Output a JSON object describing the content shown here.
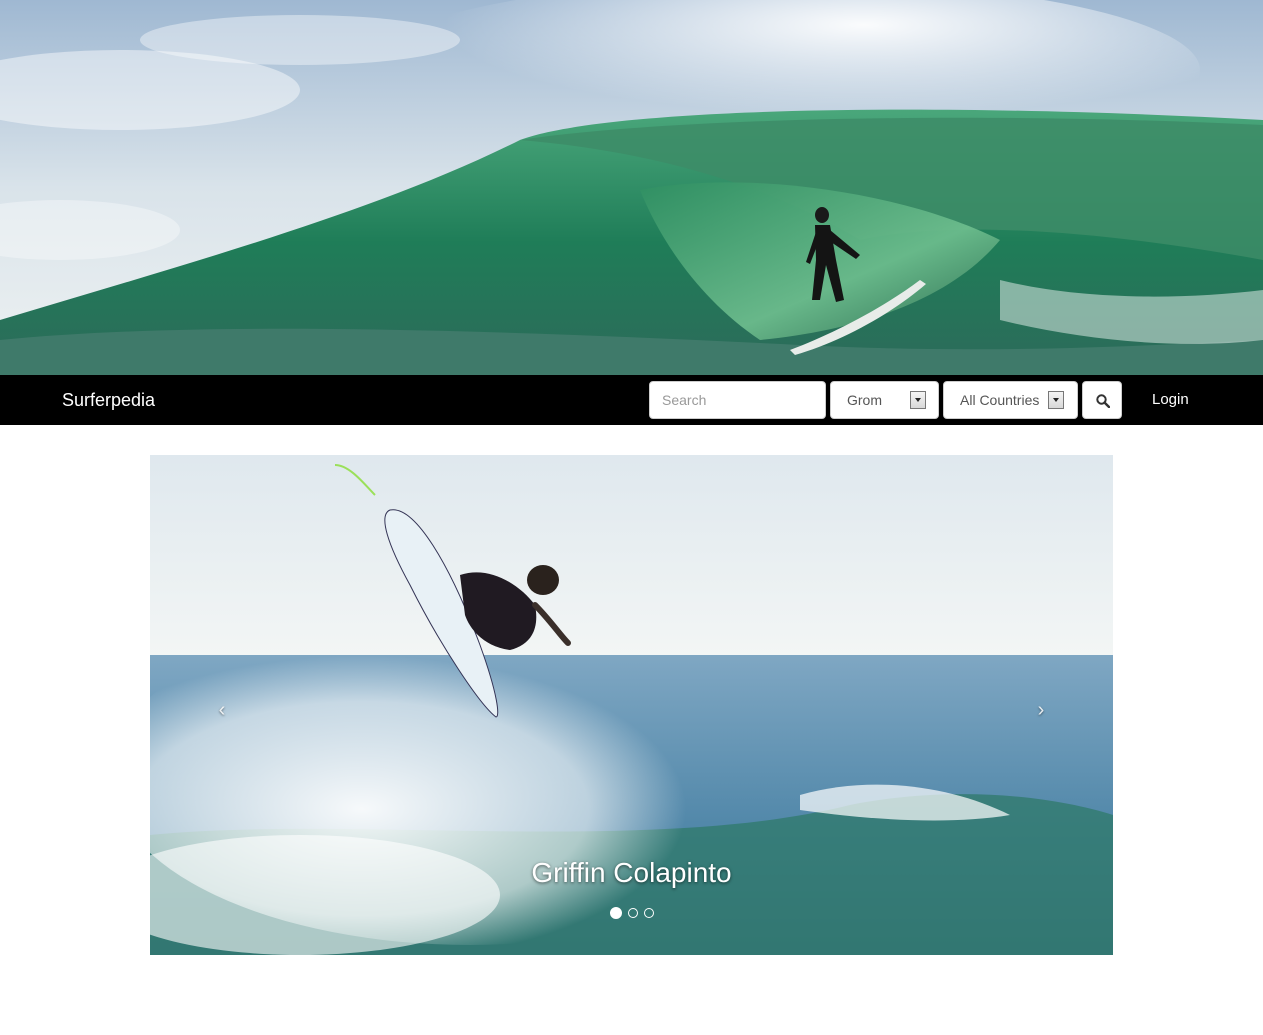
{
  "hero": {
    "image_alt": "Surfer riding inside a green barrel wave"
  },
  "navbar": {
    "brand": "Surferpedia",
    "search": {
      "placeholder": "Search",
      "value": ""
    },
    "level_select": {
      "selected": "Grom"
    },
    "country_select": {
      "selected": "All Countries"
    },
    "search_button_icon": "search-icon",
    "login_label": "Login"
  },
  "carousel": {
    "prev_label": "‹",
    "next_label": "›",
    "caption": "Griffin Colapinto",
    "slide_count": 3,
    "active_slide": 1
  },
  "colors": {
    "navbar_bg": "#000000",
    "navbar_text": "#ffffff",
    "page_bg": "#ffffff"
  }
}
